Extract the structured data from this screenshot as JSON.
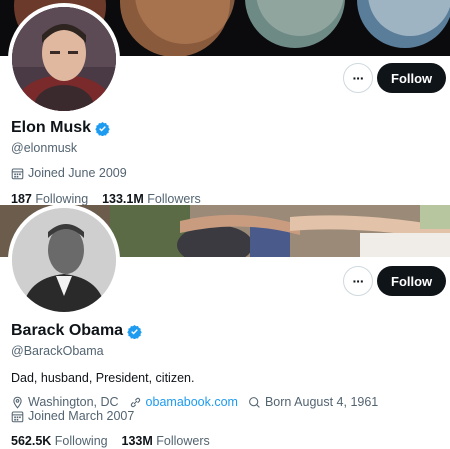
{
  "profiles": [
    {
      "name": "Elon Musk",
      "handle": "@elonmusk",
      "joined": "Joined June 2009",
      "following_count": "187",
      "following_label": "Following",
      "followers_count": "133.1M",
      "followers_label": "Followers",
      "follow_label": "Follow",
      "more_label": "···"
    },
    {
      "name": "Barack Obama",
      "handle": "@BarackObama",
      "bio": "Dad, husband, President, citizen.",
      "location": "Washington, DC",
      "website": "obamabook.com",
      "born": "Born August 4, 1961",
      "joined": "Joined March 2007",
      "following_count": "562.5K",
      "following_label": "Following",
      "followers_count": "133M",
      "followers_label": "Followers",
      "follow_label": "Follow",
      "more_label": "···"
    }
  ],
  "colors": {
    "verified_badge": "#1d9bf0",
    "link": "#1d9bf0",
    "secondary_text": "#536471",
    "follow_button_bg": "#0f1419"
  },
  "icons": {
    "verified": "verified-badge-icon",
    "calendar": "calendar-icon",
    "location": "location-pin-icon",
    "link": "link-icon",
    "birthday": "birthday-icon",
    "more": "more-options-icon"
  }
}
